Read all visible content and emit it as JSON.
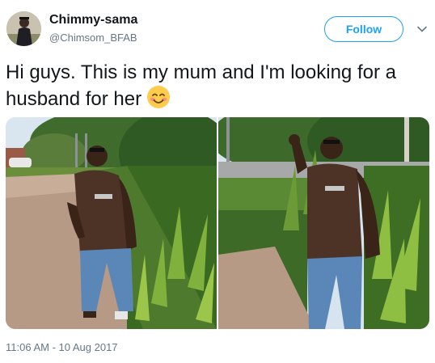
{
  "user": {
    "display_name": "Chimmy-sama",
    "handle": "@Chimsom_BFAB"
  },
  "follow_button": {
    "label": "Follow"
  },
  "tweet": {
    "text": "Hi guys. This is my mum and I'm looking for a husband for her",
    "emoji": "smiling-face-with-smiling-eyes-icon",
    "timestamp": "11:06 AM - 10 Aug 2017"
  },
  "media": {
    "photos": [
      {
        "description": "woman in brown t-shirt and jeans walking on brick path, laughing"
      },
      {
        "description": "woman in brown t-shirt and jeans waving beside plants"
      }
    ]
  },
  "colors": {
    "accent": "#1da1f2",
    "text": "#14171a",
    "secondary_text": "#657786"
  }
}
